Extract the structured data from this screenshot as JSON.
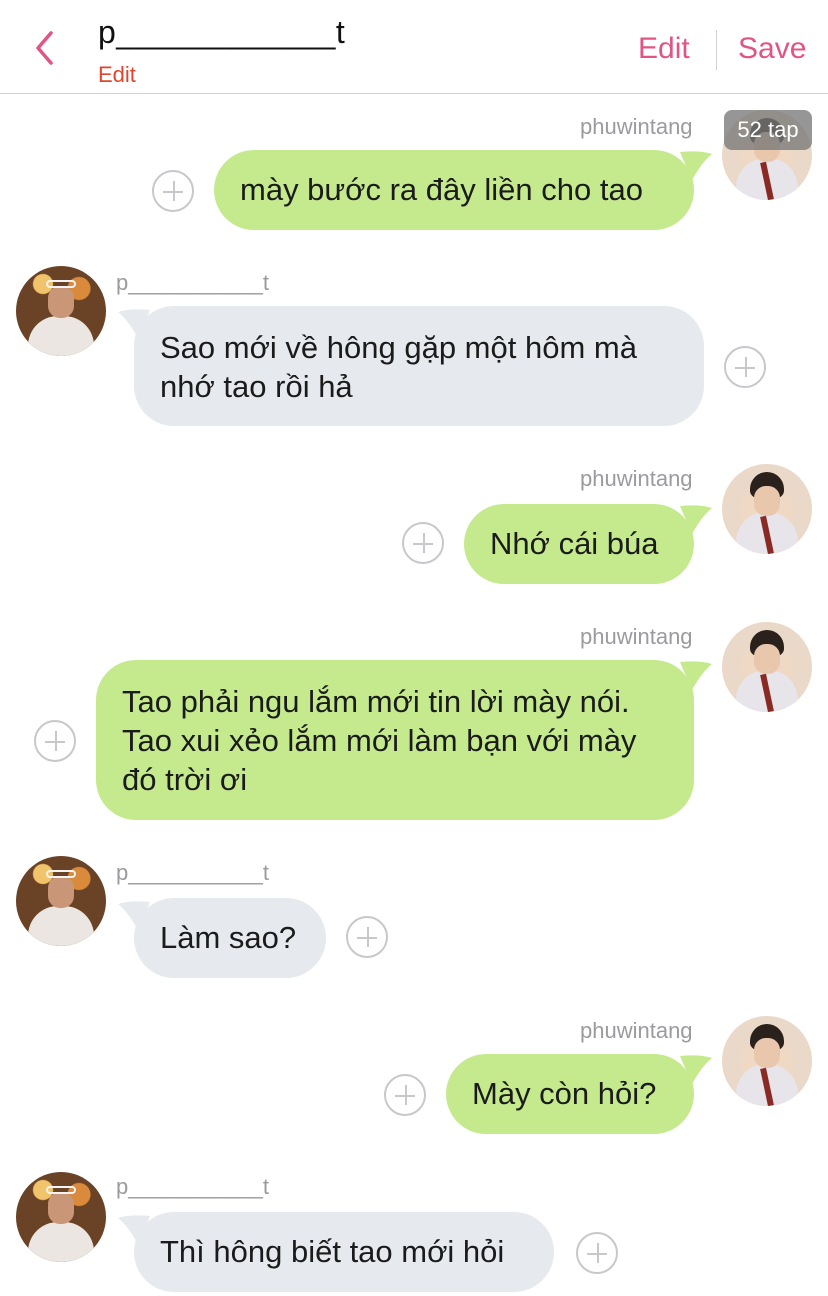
{
  "header": {
    "title": "p____________t",
    "subtitle": "Edit",
    "edit_label": "Edit",
    "save_label": "Save"
  },
  "tap_counter": "52 tap",
  "colors": {
    "accent": "#e05584",
    "subtitle": "#e0452e",
    "bubble_me": "#c5ea8e",
    "bubble_them": "#e6e9ed"
  },
  "messages": [
    {
      "sender": "phuwintang",
      "side": "right",
      "text": "mày bước ra đây liền cho tao"
    },
    {
      "sender": "p___________t",
      "side": "left",
      "text": "Sao mới về hông gặp một hôm mà\nnhớ tao rồi hả"
    },
    {
      "sender": "phuwintang",
      "side": "right",
      "text": "Nhớ cái búa"
    },
    {
      "sender": "phuwintang",
      "side": "right",
      "text": "Tao phải ngu lắm mới tin lời mày nói.\nTao xui xẻo lắm mới làm bạn với mày\nđó trời ơi"
    },
    {
      "sender": "p___________t",
      "side": "left",
      "text": "Làm sao?"
    },
    {
      "sender": "phuwintang",
      "side": "right",
      "text": "Mày còn hỏi?"
    },
    {
      "sender": "p___________t",
      "side": "left",
      "text": "Thì hông biết tao mới hỏi"
    }
  ]
}
